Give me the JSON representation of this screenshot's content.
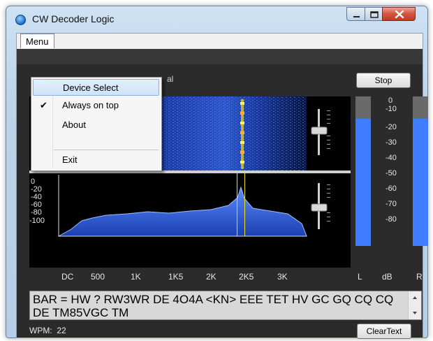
{
  "window": {
    "title": "CW Decoder Logic"
  },
  "menubar": {
    "menu_label": "Menu"
  },
  "dropdown": {
    "items": [
      {
        "label": "Device Select",
        "highlighted": true,
        "checked": false
      },
      {
        "label": "Always on top",
        "highlighted": false,
        "checked": true
      },
      {
        "label": "About",
        "highlighted": false,
        "checked": false
      },
      {
        "label": "Exit",
        "highlighted": false,
        "checked": false
      }
    ]
  },
  "panel": {
    "partial_label": "al"
  },
  "buttons": {
    "stop": "Stop",
    "clear": "ClearText"
  },
  "spectrum": {
    "y_ticks": [
      "0",
      "-20",
      "-40",
      "-60",
      "-80",
      "-100"
    ],
    "x_ticks": [
      "DC",
      "500",
      "1K",
      "1K5",
      "2K",
      "2K5",
      "3K"
    ]
  },
  "meter": {
    "scale": [
      "0",
      "-10",
      "-20",
      "-30",
      "-40",
      "-50",
      "-60",
      "-70",
      "-80"
    ],
    "left_label": "L",
    "unit_label": "dB",
    "right_label": "R",
    "left_level": 0.85,
    "right_level": 0.85
  },
  "decoded_text": "BAR = HW ? RW3WR DE 4O4A <KN> EEE TET HV GC GQ CQ CQ DE TM85VGC TM",
  "status": {
    "wpm_label": "WPM:",
    "wpm_value": "22"
  },
  "colors": {
    "signal": "#3a74ff",
    "marker": "#f0e020",
    "panel_bg": "#2b2b2b"
  }
}
